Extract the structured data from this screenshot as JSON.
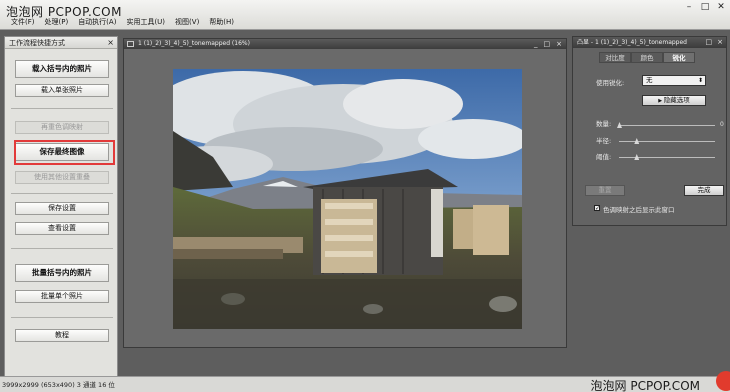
{
  "watermark_top": "泡泡网 PCPOP.COM",
  "watermark_bottom": "泡泡网 PCPOP.COM",
  "menu": [
    "文件(F)",
    "处理(P)",
    "自动执行(A)",
    "实用工具(U)",
    "视图(V)",
    "帮助(H)"
  ],
  "left_panel": {
    "title": "工作流程快捷方式",
    "close": "×",
    "load_bracketed_button": "载入括号内的照片",
    "load_single_button": "载入单张照片",
    "remap_button": "再重色调映射",
    "save_final_button": "保存最终图像",
    "use_other_settings_button": "使用其他设置重叠",
    "save_settings_button": "保存设置",
    "view_settings_button": "查看设置",
    "batch_bracketed_button": "批量括号内的照片",
    "batch_single_button": "批量单个照片",
    "tutorial_button": "教程"
  },
  "document": {
    "title": "1 (1)_2)_3)_4)_5)_tonemapped (16%)",
    "controls": [
      "_",
      "□",
      "×"
    ]
  },
  "right_panel": {
    "title": "凸显 - 1 (1)_2)_3)_4)_5)_tonemapped",
    "controls": [
      "□",
      "×"
    ],
    "tabs": [
      "对比度",
      "颜色",
      "锐化"
    ],
    "active_tab": "锐化",
    "sharpen_label": "使用锐化:",
    "sharpen_value": "无",
    "hide_options_button": "隐藏选项",
    "amount_label": "数量:",
    "amount_value": "0",
    "amount_level": 0,
    "radius_label": "半径:",
    "radius_value": "",
    "radius_level": 0.18,
    "threshold_label": "阈值:",
    "threshold_value": "",
    "threshold_level": 0.18,
    "reset_button": "重置",
    "done_button": "完成",
    "checkbox_label": "色调映射之后显示此窗口",
    "checkbox_checked": true
  },
  "status_bar": "3999x2999  (653x490)  3 通道 16 位"
}
